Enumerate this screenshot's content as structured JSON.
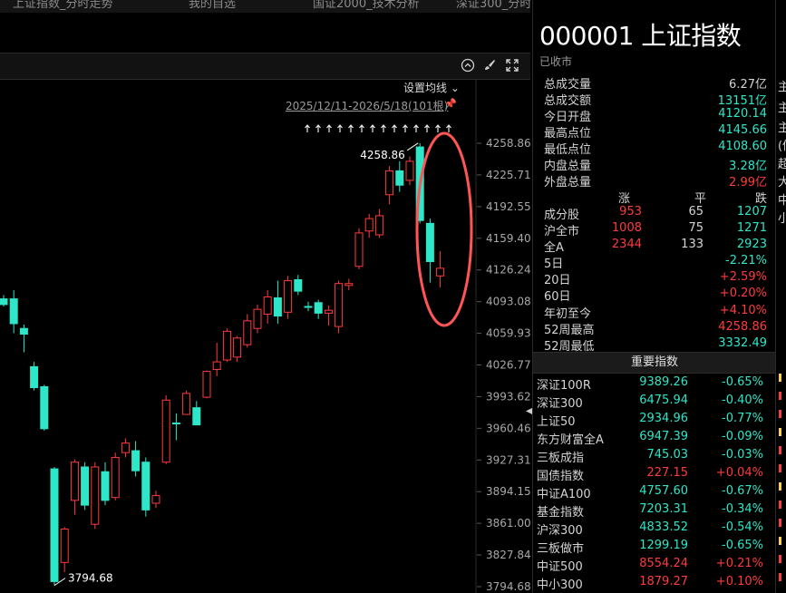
{
  "tabs": [
    "上证指数_分时走势",
    "我的自选",
    "国证2000_技术分析",
    "深证300_分时走势"
  ],
  "toolbar": {
    "icons": [
      "collapse-icon",
      "brush-icon",
      "fullscreen-icon"
    ]
  },
  "ma_setting_label": "设置均线",
  "date_range": "2025/12/11-2026/5/18(101根)",
  "stock": {
    "title": "000001 上证指数",
    "status": "已收市"
  },
  "stats": [
    {
      "label": "总成交量",
      "value": "6.27亿",
      "color": "#d4d4d4"
    },
    {
      "label": "总成交额",
      "value": "13151亿",
      "color": "#2ee6c8"
    },
    {
      "label": "今日开盘",
      "value": "4120.14",
      "color": "#2ee6c8"
    },
    {
      "label": "最高点位",
      "value": "4145.66",
      "color": "#2ee6c8"
    },
    {
      "label": "最低点位",
      "value": "4108.60",
      "color": "#2ee6c8"
    },
    {
      "label": "内盘总量",
      "value": "3.28亿",
      "color": "#2ee6c8"
    },
    {
      "label": "外盘总量",
      "value": "2.99亿",
      "color": "#ff3b3b"
    }
  ],
  "breadth": {
    "headers": [
      "涨",
      "平",
      "跌"
    ],
    "rows": [
      {
        "label": "成分股",
        "up": "953",
        "flat": "65",
        "down": "1207"
      },
      {
        "label": "沪全市",
        "up": "1008",
        "flat": "75",
        "down": "1271"
      },
      {
        "label": "全A",
        "up": "2344",
        "flat": "133",
        "down": "2923"
      }
    ]
  },
  "performance": [
    {
      "label": "5日",
      "value": "-2.21%",
      "color": "#2ee6c8"
    },
    {
      "label": "20日",
      "value": "+2.59%",
      "color": "#ff3b3b"
    },
    {
      "label": "60日",
      "value": "+0.20%",
      "color": "#ff3b3b"
    },
    {
      "label": "年初至今",
      "value": "+4.10%",
      "color": "#ff3b3b"
    },
    {
      "label": "52周最高",
      "value": "4258.86",
      "color": "#ff3b3b"
    },
    {
      "label": "52周最低",
      "value": "3332.49",
      "color": "#2ee6c8"
    }
  ],
  "indices_header": "重要指数",
  "indices": [
    {
      "name": "深证100R",
      "price": "9389.26",
      "change": "-0.65%",
      "pc": "#2ee6c8",
      "cc": "#2ee6c8"
    },
    {
      "name": "深证300",
      "price": "6475.94",
      "change": "-0.40%",
      "pc": "#2ee6c8",
      "cc": "#2ee6c8"
    },
    {
      "name": "上证50",
      "price": "2934.96",
      "change": "-0.77%",
      "pc": "#2ee6c8",
      "cc": "#2ee6c8"
    },
    {
      "name": "东方财富全A",
      "price": "6947.39",
      "change": "-0.09%",
      "pc": "#2ee6c8",
      "cc": "#2ee6c8"
    },
    {
      "name": "三板成指",
      "price": "745.03",
      "change": "-0.03%",
      "pc": "#2ee6c8",
      "cc": "#2ee6c8"
    },
    {
      "name": "国债指数",
      "price": "227.15",
      "change": "+0.04%",
      "pc": "#ff3b3b",
      "cc": "#ff3b3b"
    },
    {
      "name": "中证A100",
      "price": "4757.60",
      "change": "-0.67%",
      "pc": "#2ee6c8",
      "cc": "#2ee6c8"
    },
    {
      "name": "基金指数",
      "price": "7203.31",
      "change": "-0.34%",
      "pc": "#2ee6c8",
      "cc": "#2ee6c8"
    },
    {
      "name": "沪深300",
      "price": "4833.52",
      "change": "-0.54%",
      "pc": "#2ee6c8",
      "cc": "#2ee6c8"
    },
    {
      "name": "三板做市",
      "price": "1299.19",
      "change": "-0.65%",
      "pc": "#2ee6c8",
      "cc": "#2ee6c8"
    },
    {
      "name": "中证500",
      "price": "8554.24",
      "change": "+0.21%",
      "pc": "#ff3b3b",
      "cc": "#ff3b3b"
    },
    {
      "name": "中小300",
      "price": "1879.27",
      "change": "+0.10%",
      "pc": "#ff3b3b",
      "cc": "#ff3b3b"
    }
  ],
  "edge_chars": [
    "主",
    "主",
    "主",
    "(做",
    "超",
    "大",
    "中",
    "小"
  ],
  "chart_data": {
    "type": "candlestick",
    "ylim": [
      3794.68,
      4258.86
    ],
    "y_ticks": [
      "4258.86",
      "4225.71",
      "4192.55",
      "4159.40",
      "4126.24",
      "4093.08",
      "4059.93",
      "4026.77",
      "3993.62",
      "3960.46",
      "3927.31",
      "3894.15",
      "3861.00",
      "3827.84",
      "3794.68"
    ],
    "high_label": "4258.86",
    "low_label": "3794.68",
    "up_color": "#ff3b3b",
    "down_color": "#2ee6c8",
    "flat_color": "#2ee6c8",
    "candles": [
      {
        "o": 4096,
        "h": 4100,
        "l": 4088,
        "c": 4090
      },
      {
        "o": 4096,
        "h": 4105,
        "l": 4060,
        "c": 4070
      },
      {
        "o": 4065,
        "h": 4069,
        "l": 4040,
        "c": 4059
      },
      {
        "o": 4025,
        "h": 4030,
        "l": 4000,
        "c": 4003
      },
      {
        "o": 4004,
        "h": 4006,
        "l": 3958,
        "c": 3960
      },
      {
        "o": 3918,
        "h": 3920,
        "l": 3796,
        "c": 3800
      },
      {
        "o": 3820,
        "h": 3857,
        "l": 3810,
        "c": 3855
      },
      {
        "o": 3885,
        "h": 3928,
        "l": 3870,
        "c": 3925
      },
      {
        "o": 3920,
        "h": 3925,
        "l": 3875,
        "c": 3880
      },
      {
        "o": 3860,
        "h": 3925,
        "l": 3855,
        "c": 3920
      },
      {
        "o": 3915,
        "h": 3925,
        "l": 3880,
        "c": 3885
      },
      {
        "o": 3888,
        "h": 3935,
        "l": 3885,
        "c": 3930
      },
      {
        "o": 3935,
        "h": 3950,
        "l": 3930,
        "c": 3945
      },
      {
        "o": 3937,
        "h": 3947,
        "l": 3910,
        "c": 3916
      },
      {
        "o": 3925,
        "h": 3930,
        "l": 3868,
        "c": 3875
      },
      {
        "o": 3882,
        "h": 3895,
        "l": 3877,
        "c": 3890
      },
      {
        "o": 3925,
        "h": 3995,
        "l": 3923,
        "c": 3990
      },
      {
        "o": 3966,
        "h": 3976,
        "l": 3948,
        "c": 3966
      },
      {
        "o": 3975,
        "h": 4000,
        "l": 3975,
        "c": 3997
      },
      {
        "o": 3982,
        "h": 3989,
        "l": 3964,
        "c": 3964
      },
      {
        "o": 3993,
        "h": 4021,
        "l": 3992,
        "c": 4020
      },
      {
        "o": 4022,
        "h": 4050,
        "l": 4015,
        "c": 4030
      },
      {
        "o": 4032,
        "h": 4065,
        "l": 4030,
        "c": 4062
      },
      {
        "o": 4035,
        "h": 4057,
        "l": 4030,
        "c": 4055
      },
      {
        "o": 4048,
        "h": 4080,
        "l": 4045,
        "c": 4073
      },
      {
        "o": 4065,
        "h": 4090,
        "l": 4060,
        "c": 4085
      },
      {
        "o": 4080,
        "h": 4105,
        "l": 4070,
        "c": 4098
      },
      {
        "o": 4097,
        "h": 4115,
        "l": 4070,
        "c": 4078
      },
      {
        "o": 4082,
        "h": 4120,
        "l": 4075,
        "c": 4115
      },
      {
        "o": 4116,
        "h": 4121,
        "l": 4100,
        "c": 4104
      },
      {
        "o": 4088,
        "h": 4093,
        "l": 4083,
        "c": 4088
      },
      {
        "o": 4092,
        "h": 4095,
        "l": 4075,
        "c": 4081
      },
      {
        "o": 4081,
        "h": 4089,
        "l": 4068,
        "c": 4084
      },
      {
        "o": 4067,
        "h": 4115,
        "l": 4060,
        "c": 4112
      },
      {
        "o": 4110,
        "h": 4117,
        "l": 4105,
        "c": 4112
      },
      {
        "o": 4130,
        "h": 4170,
        "l": 4127,
        "c": 4165
      },
      {
        "o": 4167,
        "h": 4185,
        "l": 4160,
        "c": 4180
      },
      {
        "o": 4163,
        "h": 4190,
        "l": 4160,
        "c": 4183
      },
      {
        "o": 4205,
        "h": 4235,
        "l": 4195,
        "c": 4230
      },
      {
        "o": 4230,
        "h": 4240,
        "l": 4208,
        "c": 4215
      },
      {
        "o": 4220,
        "h": 4245,
        "l": 4215,
        "c": 4240
      },
      {
        "o": 4255,
        "h": 4259,
        "l": 4175,
        "c": 4178
      },
      {
        "o": 4175,
        "h": 4180,
        "l": 4113,
        "c": 4135
      },
      {
        "o": 4120,
        "h": 4146,
        "l": 4108,
        "c": 4128
      }
    ]
  }
}
